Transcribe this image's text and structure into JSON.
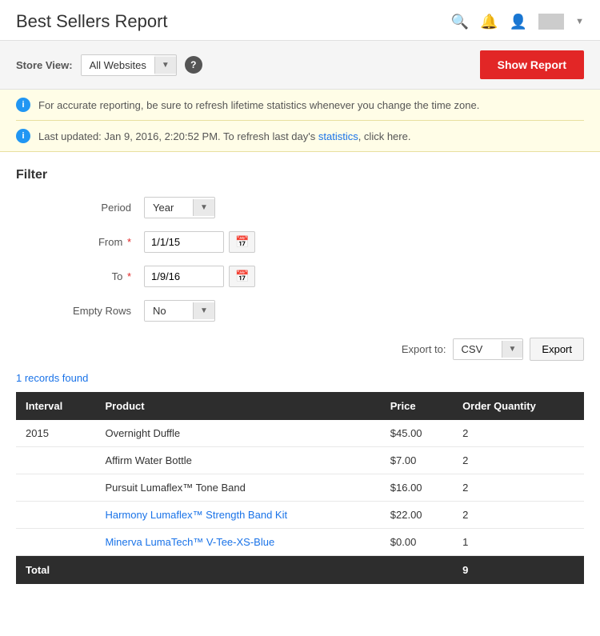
{
  "header": {
    "title": "Best Sellers Report",
    "icons": {
      "search": "🔍",
      "bell": "🔔",
      "user": "👤"
    }
  },
  "store_view_bar": {
    "label": "Store View:",
    "selected": "All Websites",
    "help_icon": "?",
    "show_report_button": "Show Report"
  },
  "info_banners": [
    {
      "text": "For accurate reporting, be sure to refresh lifetime statistics whenever you change the time zone."
    },
    {
      "text_before": "Last updated: Jan 9, 2016, 2:20:52 PM. To refresh last day's ",
      "link_text": "statistics",
      "text_after": ", click here."
    }
  ],
  "filter": {
    "section_title": "Filter",
    "period_label": "Period",
    "period_value": "Year",
    "from_label": "From",
    "from_value": "1/1/15",
    "to_label": "To",
    "to_value": "1/9/16",
    "empty_rows_label": "Empty Rows",
    "empty_rows_value": "No"
  },
  "export": {
    "label": "Export to:",
    "format": "CSV",
    "button": "Export"
  },
  "records_found": "1 records found",
  "table": {
    "columns": [
      "Interval",
      "Product",
      "Price",
      "Order Quantity"
    ],
    "rows": [
      {
        "interval": "2015",
        "product": "Overnight Duffle",
        "price": "$45.00",
        "qty": "2",
        "is_link": false
      },
      {
        "interval": "",
        "product": "Affirm Water Bottle",
        "price": "$7.00",
        "qty": "2",
        "is_link": false
      },
      {
        "interval": "",
        "product": "Pursuit Lumaflex™ Tone Band",
        "price": "$16.00",
        "qty": "2",
        "is_link": false
      },
      {
        "interval": "",
        "product": "Harmony Lumaflex™ Strength Band Kit",
        "price": "$22.00",
        "qty": "2",
        "is_link": true
      },
      {
        "interval": "",
        "product": "Minerva LumaTech™ V-Tee-XS-Blue",
        "price": "$0.00",
        "qty": "1",
        "is_link": true
      }
    ],
    "footer": {
      "label": "Total",
      "qty": "9"
    }
  }
}
